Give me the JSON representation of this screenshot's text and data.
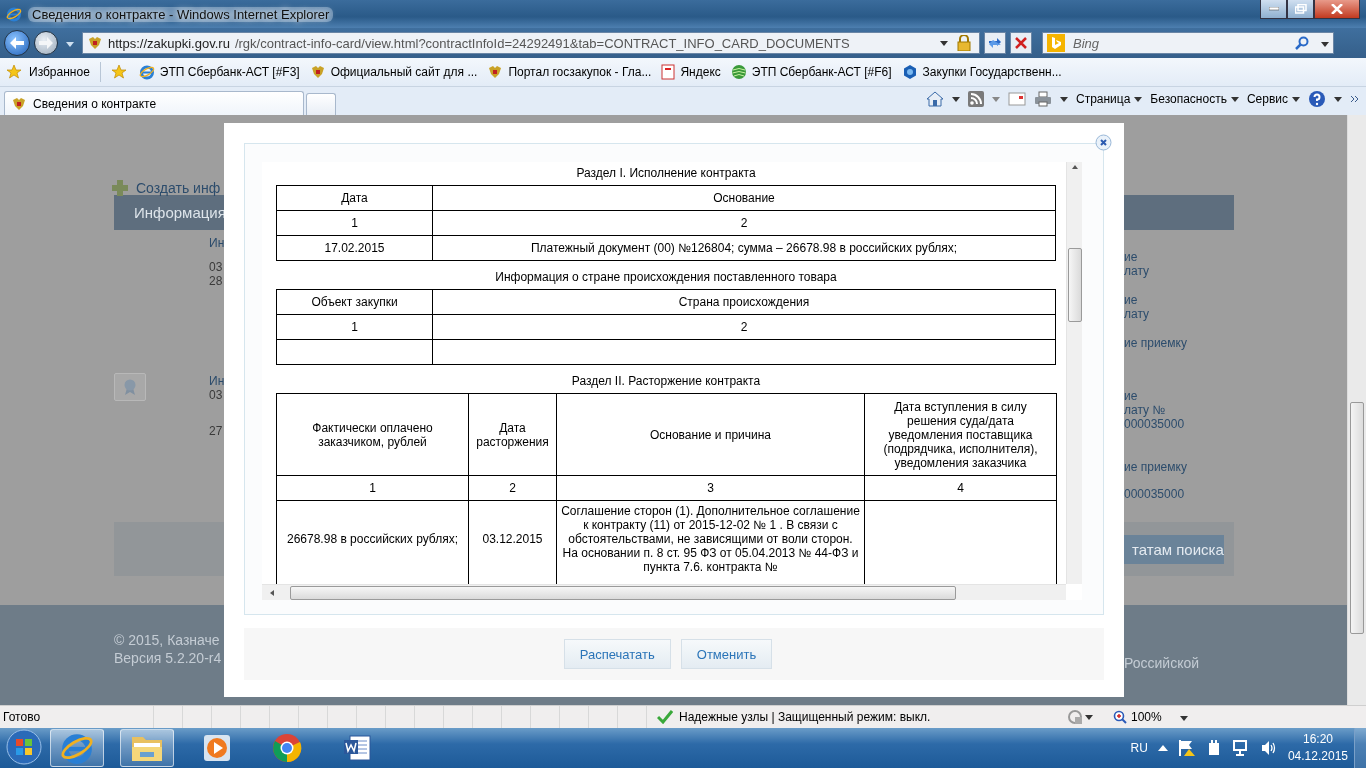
{
  "window": {
    "title": "Сведения о контракте - Windows Internet Explorer"
  },
  "address_bar": {
    "url_host": "https://zakupki.gov.ru",
    "url_path": "/rgk/contract-info-card/view.html?contractInfoId=24292491&tab=CONTRACT_INFO_CARD_DOCUMENTS"
  },
  "search": {
    "placeholder": "Bing"
  },
  "favorites_bar": {
    "label": "Избранное",
    "items": [
      {
        "label": "ЭТП Сбербанк-АСТ [#F3]",
        "kind": "ie"
      },
      {
        "label": "Официальный сайт для ...",
        "kind": "emblem"
      },
      {
        "label": "Портал госзакупок - Гла...",
        "kind": "emblem"
      },
      {
        "label": "Яндекс",
        "kind": "page"
      },
      {
        "label": "ЭТП Сбербанк-АСТ [#F6]",
        "kind": "sphere"
      },
      {
        "label": "Закупки  Государственн...",
        "kind": "hexagon"
      }
    ]
  },
  "tabs": [
    {
      "label": "Сведения о контракте",
      "selected": true
    }
  ],
  "command_bar": [
    "Страница",
    "Безопасность",
    "Сервис"
  ],
  "page_background": {
    "create_link": "Создать инф",
    "header": "Информация",
    "left_lines": [
      "Ин",
      "03",
      "28",
      "Ин",
      "03",
      "27"
    ],
    "right_lines": [
      "ие",
      "лату",
      "ие",
      "лату",
      "ие приемку",
      "ие",
      "лату №",
      "000035000",
      "ие приемку",
      "000035000"
    ],
    "back_button": "татам поиска",
    "footer_left": [
      "© 2015, Казначе",
      "Версия 5.2.20-r4"
    ],
    "footer_right": "Российской"
  },
  "dialog": {
    "sections": [
      {
        "heading": "Раздел I. Исполнение контракта",
        "columns": [
          "Дата",
          "Основание"
        ],
        "numbers": [
          "1",
          "2"
        ],
        "rows": [
          [
            "17.02.2015",
            "Платежный документ (00) №126804; сумма – 26678.98 в российских рублях;"
          ]
        ]
      },
      {
        "heading": "Информация о стране происхождения поставленного товара",
        "columns": [
          "Объект закупки",
          "Страна происхождения"
        ],
        "numbers": [
          "1",
          "2"
        ],
        "blank_row": true
      },
      {
        "heading": "Раздел II. Расторжение контракта",
        "columns": [
          "Фактически оплачено заказчиком, рублей",
          "Дата расторжения",
          "Основание и причина",
          "Дата вступления в силу решения суда/дата уведомления поставщика (подрядчика, исполнителя), уведомления заказчика"
        ],
        "numbers": [
          "1",
          "2",
          "3",
          "4"
        ],
        "rows": [
          [
            "26678.98 в российских рублях;",
            "03.12.2015",
            "Соглашение сторон (1).  Дополнительное соглашение к контракту (11) от 2015-12-02 № 1 . В связи с обстоятельствами, не зависящими от воли сторон. На основании п. 8 ст. 95 ФЗ от 05.04.2013 № 44-ФЗ и пункта 7.6. контракта №",
            ""
          ]
        ]
      }
    ],
    "buttons": [
      "Распечатать",
      "Отменить"
    ]
  },
  "status_bar": {
    "text": "Готово",
    "zone": "Надежные узлы | Защищенный режим: выкл.",
    "zoom": "100%"
  },
  "taskbar": {
    "apps": [
      {
        "kind": "ie",
        "running": true
      },
      {
        "kind": "folder",
        "running": true
      },
      {
        "kind": "media",
        "running": false
      },
      {
        "kind": "chrome",
        "running": false
      },
      {
        "kind": "word",
        "running": false
      }
    ],
    "language": "RU",
    "time": "16:20",
    "date": "04.12.2015"
  }
}
